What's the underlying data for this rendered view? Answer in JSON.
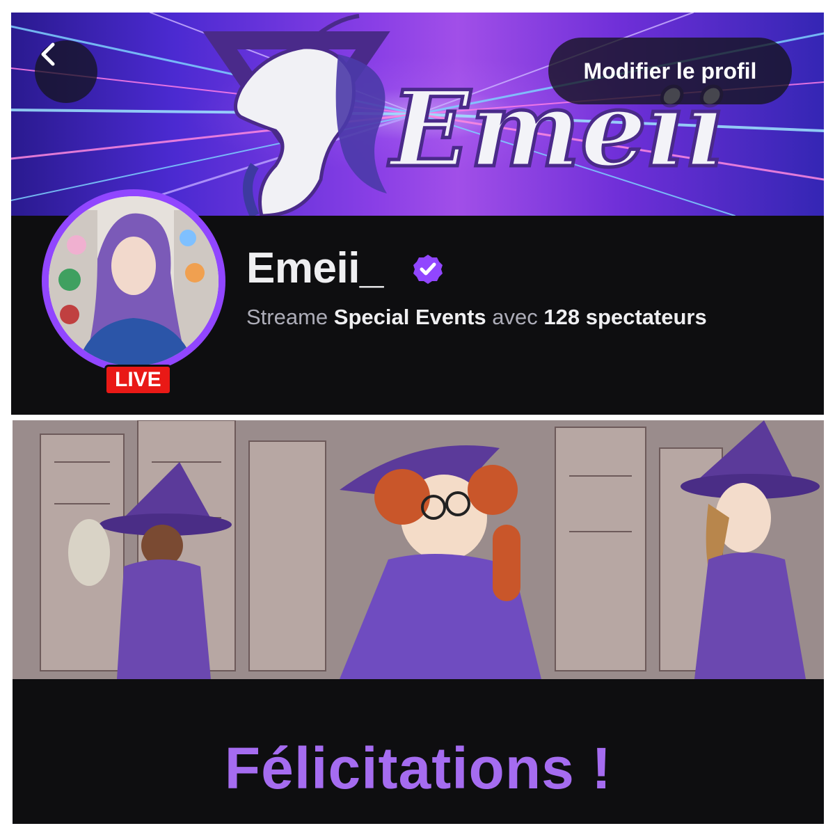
{
  "header": {
    "back_icon": "chevron-left-icon",
    "edit_profile_label": "Modifier le profil",
    "banner_logo_text": "Emeii"
  },
  "profile": {
    "username": "Emeii_",
    "verified_icon": "verified-badge-icon",
    "live_label": "LIVE",
    "stream_prefix": "Streame",
    "category": "Special Events",
    "stream_middle": "avec",
    "viewers": "128 spectateurs"
  },
  "congrats": {
    "text": "Félicitations !"
  },
  "colors": {
    "twitch_purple": "#9146ff",
    "live_red": "#e91916",
    "congrats_purple": "#a56cf0",
    "background": "#0e0e10"
  }
}
